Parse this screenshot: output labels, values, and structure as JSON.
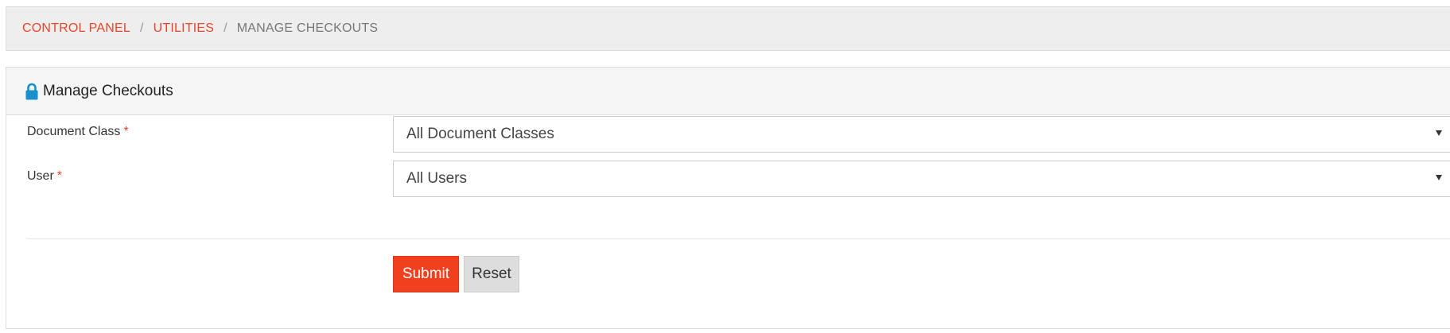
{
  "breadcrumb": {
    "items": [
      {
        "label": "CONTROL PANEL"
      },
      {
        "label": "UTILITIES"
      },
      {
        "label": "MANAGE CHECKOUTS"
      }
    ],
    "separator": "/"
  },
  "panel": {
    "title": "Manage Checkouts",
    "icon": "lock-icon"
  },
  "form": {
    "document_class": {
      "label": "Document Class",
      "required_mark": "*",
      "selected": "All Document Classes"
    },
    "user": {
      "label": "User",
      "required_mark": "*",
      "selected": "All Users"
    },
    "submit_label": "Submit",
    "reset_label": "Reset"
  },
  "colors": {
    "accent": "#f0401e",
    "link": "#e8452c",
    "lock_icon": "#1a8fc9"
  }
}
